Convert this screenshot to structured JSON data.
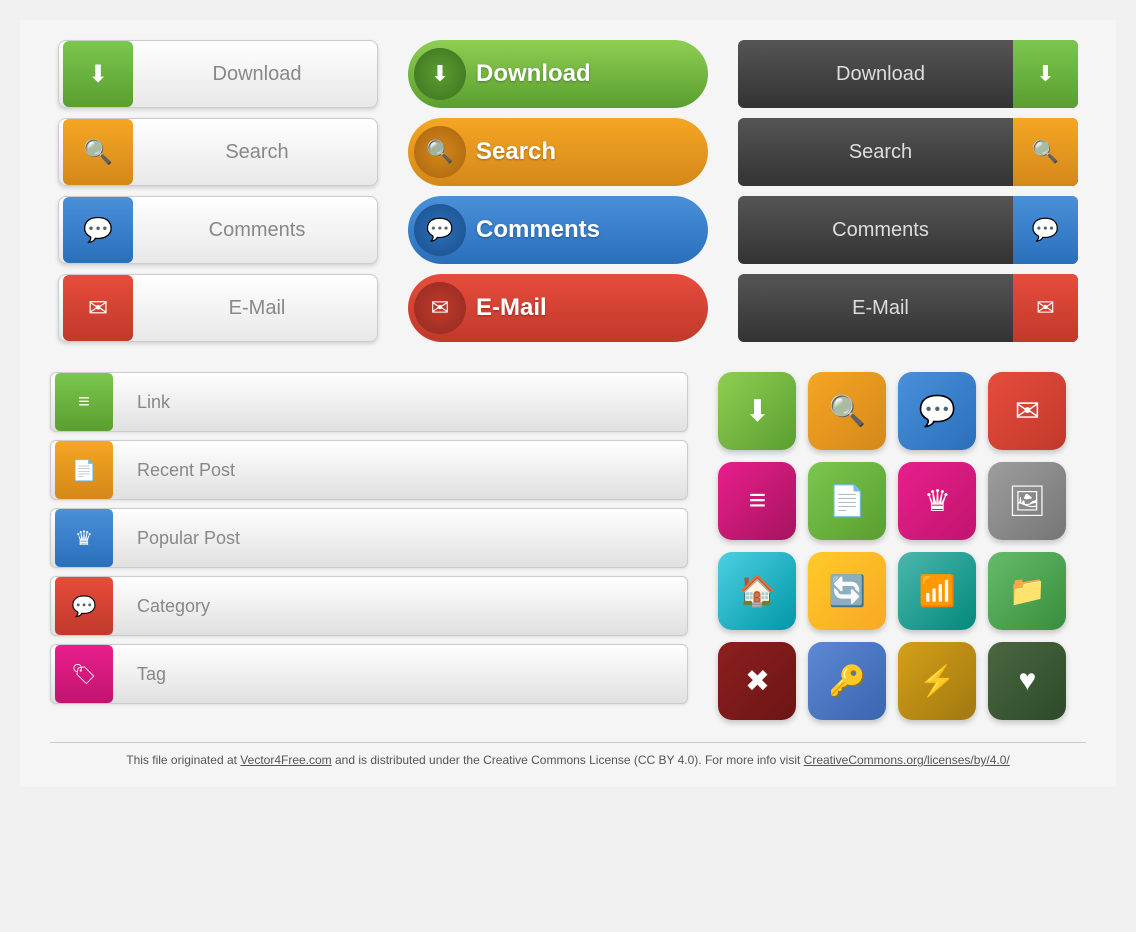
{
  "buttons": {
    "light": [
      {
        "label": "Download",
        "icon": "⬇",
        "iconClass": "icon-green"
      },
      {
        "label": "Search",
        "icon": "🔍",
        "iconClass": "icon-orange"
      },
      {
        "label": "Comments",
        "icon": "💬",
        "iconClass": "icon-blue"
      },
      {
        "label": "E-Mail",
        "icon": "✉",
        "iconClass": "icon-red"
      }
    ],
    "bold": [
      {
        "label": "Download",
        "icon": "⬇",
        "btnClass": "btn-bold-green",
        "circleClass": "circle-green"
      },
      {
        "label": "Search",
        "icon": "🔍",
        "btnClass": "btn-bold-orange",
        "circleClass": "circle-orange"
      },
      {
        "label": "Comments",
        "icon": "💬",
        "btnClass": "btn-bold-blue",
        "circleClass": "circle-blue"
      },
      {
        "label": "E-Mail",
        "icon": "✉",
        "btnClass": "btn-bold-red",
        "circleClass": "circle-red"
      }
    ],
    "dark": [
      {
        "label": "Download",
        "icon": "⬇",
        "iconClass": "icon-box-dark-green"
      },
      {
        "label": "Search",
        "icon": "🔍",
        "iconClass": "icon-box-dark-orange"
      },
      {
        "label": "Comments",
        "icon": "💬",
        "iconClass": "icon-box-dark-blue"
      },
      {
        "label": "E-Mail",
        "icon": "✉",
        "iconClass": "icon-box-dark-red"
      }
    ],
    "list": [
      {
        "label": "Link",
        "icon": "≡",
        "iconClass": "icon-green2"
      },
      {
        "label": "Recent Post",
        "icon": "📄",
        "iconClass": "icon-orange2"
      },
      {
        "label": "Popular Post",
        "icon": "♛",
        "iconClass": "icon-blue2"
      },
      {
        "label": "Category",
        "icon": "💬",
        "iconClass": "icon-red2"
      },
      {
        "label": "Tag",
        "icon": "🏷",
        "iconClass": "icon-pink2"
      }
    ]
  },
  "icons": [
    {
      "icon": "⬇",
      "tileClass": "tile-green"
    },
    {
      "icon": "🔍",
      "tileClass": "tile-orange"
    },
    {
      "icon": "💬",
      "tileClass": "tile-blue-light"
    },
    {
      "icon": "✉",
      "tileClass": "tile-red"
    },
    {
      "icon": "≡",
      "tileClass": "tile-pink"
    },
    {
      "icon": "📄",
      "tileClass": "tile-green2"
    },
    {
      "icon": "♛",
      "tileClass": "tile-pink2"
    },
    {
      "icon": "🖼",
      "tileClass": "tile-gray"
    },
    {
      "icon": "🏠",
      "tileClass": "tile-cyan"
    },
    {
      "icon": "🔄",
      "tileClass": "tile-yellow"
    },
    {
      "icon": "📶",
      "tileClass": "tile-teal"
    },
    {
      "icon": "📁",
      "tileClass": "tile-green3"
    },
    {
      "icon": "✖",
      "tileClass": "tile-darkred"
    },
    {
      "icon": "🔑",
      "tileClass": "tile-blue2"
    },
    {
      "icon": "⚡",
      "tileClass": "tile-goldenrod"
    },
    {
      "icon": "♥",
      "tileClass": "tile-darkgreen"
    }
  ],
  "footer": {
    "text": "This file originated at Vector4Free.com and is distributed under the Creative Commons License (CC BY 4.0). For more info visit CreativeCommons.org/licenses/by/4.0/",
    "link1": "Vector4Free.com",
    "link2": "CreativeCommons.org/licenses/by/4.0/"
  }
}
